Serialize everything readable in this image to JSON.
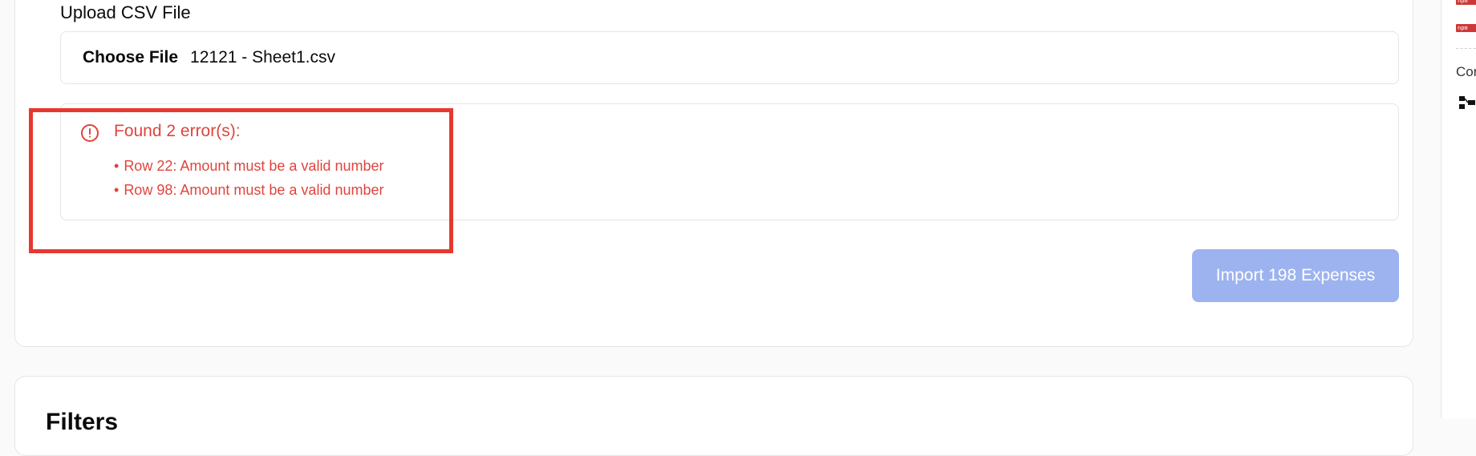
{
  "upload": {
    "label": "Upload CSV File",
    "choose_file_label": "Choose File",
    "file_name": "12121 - Sheet1.csv"
  },
  "errors": {
    "title": "Found 2 error(s):",
    "bullet": "•",
    "items": [
      "Row 22: Amount must be a valid number",
      "Row 98: Amount must be a valid number"
    ],
    "icon": "alert-circle-icon",
    "color": "#e0443d"
  },
  "import_button": {
    "label": "Import 198 Expenses",
    "disabled": true,
    "color": "#9db3f0"
  },
  "filters": {
    "title": "Filters"
  },
  "right_panel": {
    "badge_text": "npm",
    "label": "Cor",
    "icon": "flow-diagram-icon"
  },
  "highlight_color": "#e53930"
}
